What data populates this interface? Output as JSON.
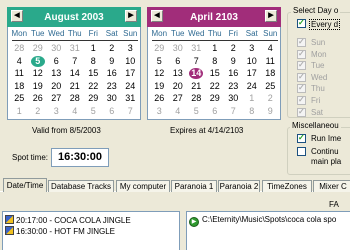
{
  "calendar_left": {
    "title": "August 2003",
    "color": "#2aa98b",
    "sel_color": "#2aa98b",
    "dows": [
      "Mon",
      "Tue",
      "Wed",
      "Thu",
      "Fri",
      "Sat",
      "Sun"
    ],
    "days": [
      [
        "28",
        "29",
        "30",
        "31",
        "1",
        "2",
        "3"
      ],
      [
        "4",
        "5",
        "6",
        "7",
        "8",
        "9",
        "10"
      ],
      [
        "11",
        "12",
        "13",
        "14",
        "15",
        "16",
        "17"
      ],
      [
        "18",
        "19",
        "20",
        "21",
        "22",
        "23",
        "24"
      ],
      [
        "25",
        "26",
        "27",
        "28",
        "29",
        "30",
        "31"
      ],
      [
        "1",
        "2",
        "3",
        "4",
        "5",
        "6",
        "7"
      ]
    ],
    "selected": "5",
    "valid_from": "Valid from  8/5/2003"
  },
  "calendar_right": {
    "title": "April 2103",
    "color": "#a12d7a",
    "sel_color": "#a12d7a",
    "dows": [
      "Mon",
      "Tue",
      "Wed",
      "Thu",
      "Fri",
      "Sat",
      "Sun"
    ],
    "days": [
      [
        "29",
        "30",
        "31",
        "1",
        "2",
        "3",
        "4"
      ],
      [
        "5",
        "6",
        "7",
        "8",
        "9",
        "10",
        "11"
      ],
      [
        "12",
        "13",
        "14",
        "15",
        "16",
        "17",
        "18"
      ],
      [
        "19",
        "20",
        "21",
        "22",
        "23",
        "24",
        "25"
      ],
      [
        "26",
        "27",
        "28",
        "29",
        "30",
        "1",
        "2"
      ],
      [
        "3",
        "4",
        "5",
        "6",
        "7",
        "8",
        "9"
      ]
    ],
    "selected": "14",
    "expires": "Expires at  4/14/2103"
  },
  "spot_time": {
    "label": "Spot time:",
    "value": "16:30:00"
  },
  "select_day": {
    "title": "Select Day o",
    "every": "Every d",
    "days": [
      "Sun",
      "Mon",
      "Tue",
      "Wed",
      "Thu",
      "Fri",
      "Sat"
    ]
  },
  "misc": {
    "title": "Miscellaneou",
    "run": "Run Ime",
    "continue_1": "Continu",
    "continue_2": "main pla"
  },
  "tabs": [
    "Date/Time",
    "Database Tracks",
    "My computer",
    "Paranoia 1",
    "Paranoia 2",
    "TimeZones",
    "Mixer C"
  ],
  "fa_label": "FA",
  "jingles": [
    "20:17:00 - COCA COLA JINGLE",
    "16:30:00 - HOT FM JINGLE"
  ],
  "path": "C:\\Eternity\\Music\\Spots\\coca cola spo"
}
